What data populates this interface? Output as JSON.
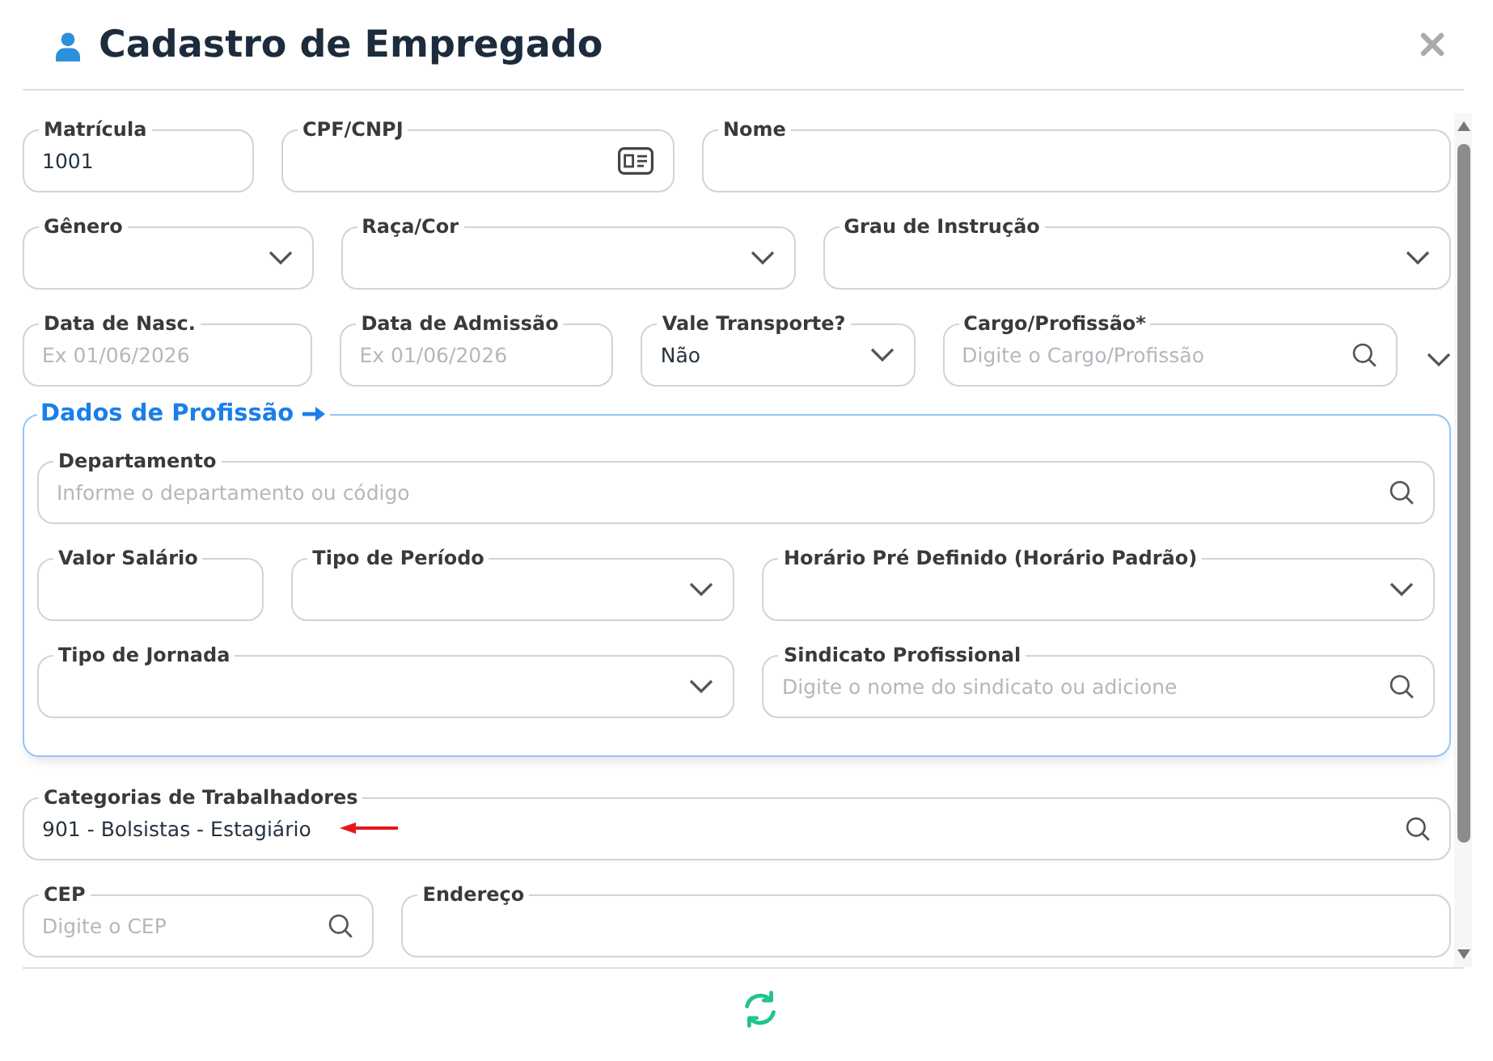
{
  "window": {
    "title": "Cadastro de Empregado"
  },
  "personal_rows": [
    [
      {
        "kind": "text",
        "label": "Matrícula",
        "value": "1001"
      },
      {
        "kind": "document",
        "label": "CPF/CNPJ"
      },
      {
        "kind": "text",
        "label": "Nome"
      }
    ],
    [
      {
        "kind": "select",
        "label": "Gênero"
      },
      {
        "kind": "select",
        "label": "Raça/Cor"
      },
      {
        "kind": "select",
        "label": "Grau de Instrução"
      }
    ],
    [
      {
        "kind": "date",
        "label": "Data de Nasc.",
        "placeholder": "Ex 01/06/2026"
      },
      {
        "kind": "date",
        "label": "Data de Admissão",
        "placeholder": "Ex 01/06/2026"
      },
      {
        "kind": "select",
        "label": "Vale Transporte?",
        "value": "Não"
      },
      {
        "kind": "search",
        "label": "Cargo/Profissão*",
        "placeholder": "Digite o Cargo/Profissão"
      },
      {
        "kind": "expander"
      }
    ]
  ],
  "profession_section": {
    "title": "Dados de Profissão",
    "rows": [
      [
        {
          "kind": "search",
          "label": "Departamento",
          "placeholder": "Informe o departamento ou código",
          "colspan": 3
        }
      ],
      [
        {
          "kind": "text",
          "label": "Valor Salário"
        },
        {
          "kind": "select",
          "label": "Tipo de Período"
        },
        {
          "kind": "select",
          "label": "Horário Pré Definido (Horário Padrão)"
        }
      ],
      [
        {
          "kind": "select",
          "label": "Tipo de Jornada",
          "colspan": 2
        },
        {
          "kind": "search",
          "label": "Sindicato Profissional",
          "placeholder": "Digite o nome do sindicato ou adicione"
        }
      ]
    ]
  },
  "more_rows": [
    [
      {
        "kind": "search",
        "label": "Categorias de Trabalhadores",
        "value": "901 - Bolsistas - Estagiário",
        "annotated": true
      }
    ],
    [
      {
        "kind": "search",
        "label": "CEP",
        "placeholder": "Digite o CEP",
        "annotated": false
      },
      {
        "kind": "text",
        "label": "Endereço",
        "annotated": false
      }
    ]
  ]
}
